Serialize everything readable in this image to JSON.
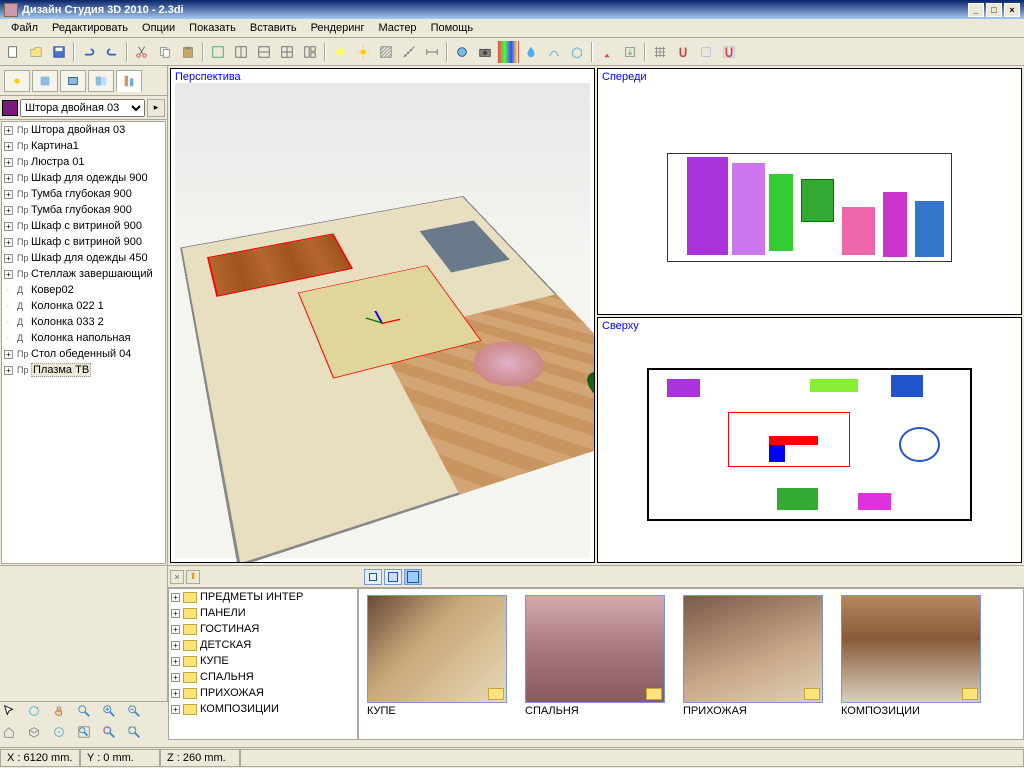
{
  "window": {
    "title": "Дизайн Студия 3D 2010 - 2.3di"
  },
  "menu": [
    "Файл",
    "Редактировать",
    "Опции",
    "Показать",
    "Вставить",
    "Рендеринг",
    "Мастер",
    "Помощь"
  ],
  "sidebar": {
    "dropdown": "Штора двойная 03",
    "items": [
      {
        "type": "Пр",
        "label": "Штора двойная 03"
      },
      {
        "type": "Пр",
        "label": "Картина1"
      },
      {
        "type": "Пр",
        "label": "Люстра 01"
      },
      {
        "type": "Пр",
        "label": "Шкаф для одежды 900"
      },
      {
        "type": "Пр",
        "label": "Тумба глубокая 900"
      },
      {
        "type": "Пр",
        "label": "Тумба глубокая 900"
      },
      {
        "type": "Пр",
        "label": "Шкаф с витриной 900"
      },
      {
        "type": "Пр",
        "label": "Шкаф с витриной 900"
      },
      {
        "type": "Пр",
        "label": "Шкаф для одежды 450"
      },
      {
        "type": "Пр",
        "label": "Стеллаж завершающий"
      },
      {
        "type": "Д",
        "label": "Ковер02",
        "leaf": true
      },
      {
        "type": "Д",
        "label": "Колонка 022 1",
        "leaf": true
      },
      {
        "type": "Д",
        "label": "Колонка 033 2",
        "leaf": true
      },
      {
        "type": "Д",
        "label": "Колонка напольная",
        "leaf": true
      },
      {
        "type": "Пр",
        "label": "Стол обеденный 04"
      },
      {
        "type": "Пр",
        "label": "Плазма ТВ",
        "sel": true
      }
    ]
  },
  "viewports": {
    "persp": "Перспектива",
    "front": "Спереди",
    "top": "Сверху"
  },
  "categories": [
    "ПРЕДМЕТЫ ИНТЕР",
    "ПАНЕЛИ",
    "ГОСТИНАЯ",
    "ДЕТСКАЯ",
    "КУПЕ",
    "СПАЛЬНЯ",
    "ПРИХОЖАЯ",
    "КОМПОЗИЦИИ"
  ],
  "thumbs": [
    "КУПЕ",
    "СПАЛЬНЯ",
    "ПРИХОЖАЯ",
    "КОМПОЗИЦИИ"
  ],
  "status": {
    "x": "X : 6120 mm.",
    "y": "Y : 0 mm.",
    "z": "Z : 260 mm."
  }
}
